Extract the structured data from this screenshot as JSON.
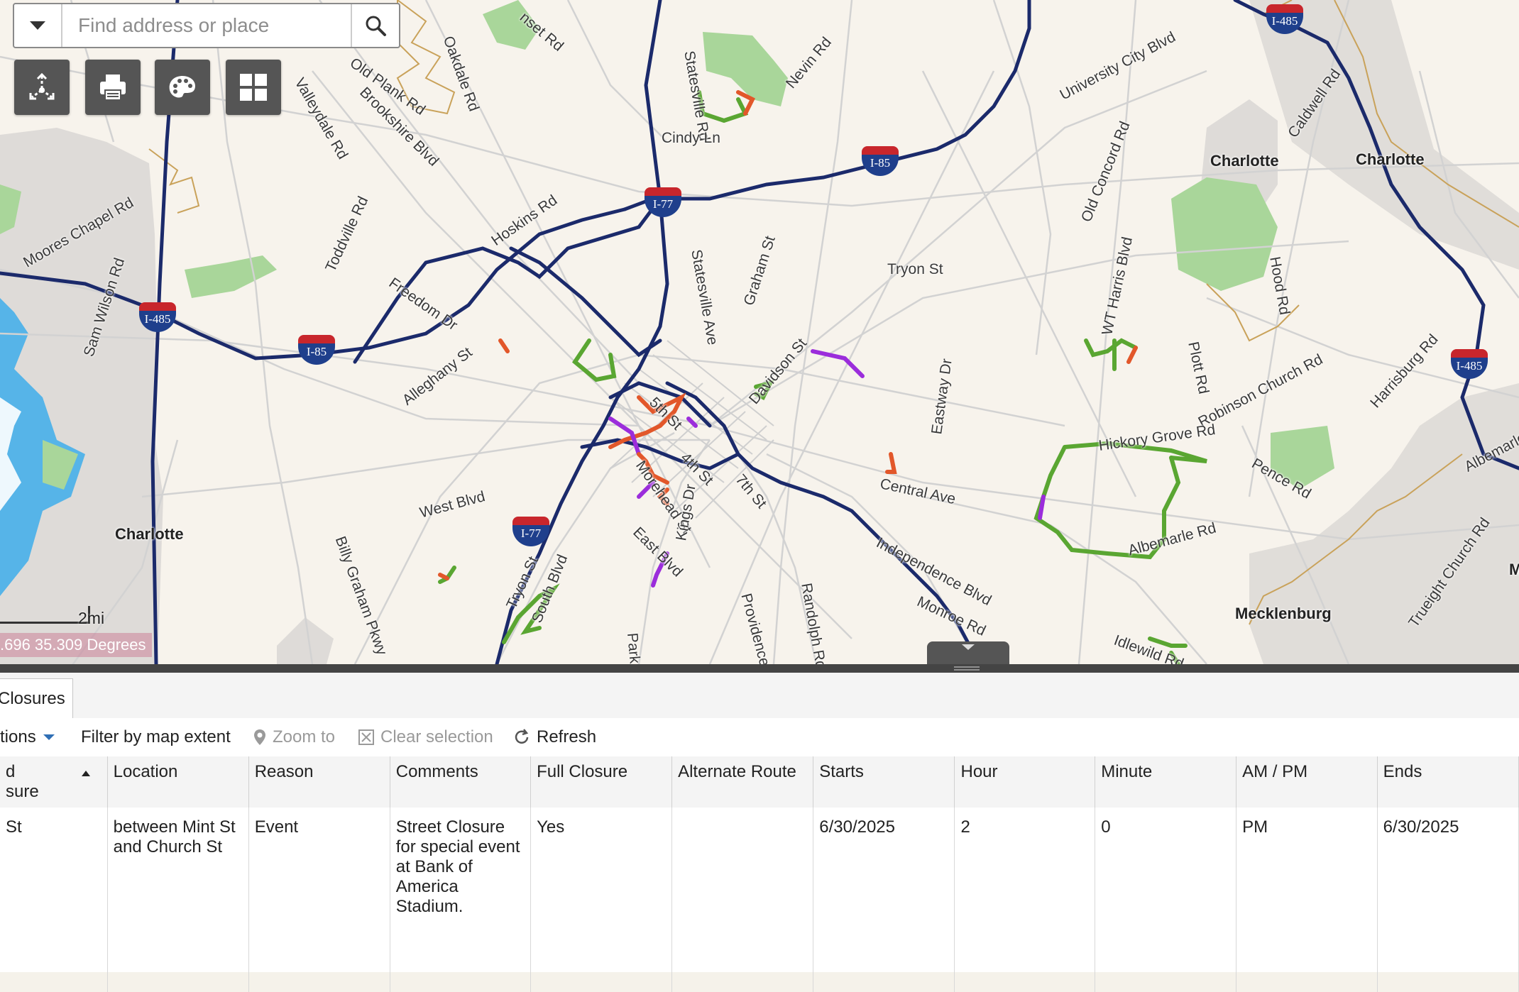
{
  "search": {
    "placeholder": "Find address or place"
  },
  "toolbar": {
    "tools": [
      {
        "name": "measure",
        "icon": "measure-icon"
      },
      {
        "name": "print",
        "icon": "printer-icon"
      },
      {
        "name": "basemap",
        "icon": "palette-icon"
      },
      {
        "name": "gallery",
        "icon": "grid-icon"
      }
    ]
  },
  "map": {
    "scale_label": "2mi",
    "coordinates": ".696 35.309 Degrees",
    "colors": {
      "water": "#56b4e8",
      "park": "#a9d69a",
      "highway": "#1b2a6b",
      "road": "#d2d2d2",
      "boundary": "#c9a25a",
      "closure_full": "#e2572a",
      "closure_partial": "#5aa632",
      "closure_event": "#9b2ddb"
    },
    "cities": [
      "Charlotte",
      "Charlotte",
      "Charlotte",
      "Mecklenburg",
      "M"
    ],
    "roads": [
      "nset Rd",
      "Oakdale Rd",
      "Old Plank Rd",
      "Brookshire Blvd",
      "Valleydale Rd",
      "Statesville Rd",
      "Nevin Rd",
      "University City Blvd",
      "Caldwell Rd",
      "Cindy Ln",
      "Old Concord Rd",
      "Moores Chapel Rd",
      "Toddville Rd",
      "Hoskins Rd",
      "Statesville Ave",
      "Graham St",
      "Tryon St",
      "WT Harris Blvd",
      "Hood Rd",
      "Sam Wilson Rd",
      "Freedom Dr",
      "Plott Rd",
      "Robinson Church Rd",
      "Harrisburg Rd",
      "Alleghany St",
      "Davidson St",
      "5th St",
      "4th St",
      "7th St",
      "Eastway Dr",
      "Hickory Grove Rd",
      "Pence Rd",
      "Albemarle",
      "Morehead St",
      "Central Ave",
      "West Blvd",
      "East Blvd",
      "Kings Dr",
      "Independence Blvd",
      "Albemarle Rd",
      "Billy Graham Pkwy",
      "Tryon St",
      "South Blvd",
      "Park Rd",
      "Providence Rd",
      "Randolph Rd",
      "Monroe Rd",
      "Idlewild Rd",
      "Trueight Church Rd",
      "Albemarle Rd"
    ],
    "shields": [
      "I-485",
      "I-85",
      "I-77",
      "I-485",
      "I-85",
      "I-77",
      "I-485"
    ]
  },
  "panel": {
    "tab_label": "Closures",
    "options_label": "tions",
    "filter_label": "Filter by map extent",
    "zoom_label": "Zoom to",
    "clear_label": "Clear selection",
    "refresh_label": "Refresh",
    "columns": [
      "d\nsure",
      "Location",
      "Reason",
      "Comments",
      "Full Closure",
      "Alternate Route",
      "Starts",
      "Hour",
      "Minute",
      "AM / PM",
      "Ends"
    ],
    "rows": [
      {
        "street": "St",
        "location": "between Mint St and Church St",
        "reason": "Event",
        "comments": "Street Closure for special event at Bank of America Stadium.",
        "full_closure": "Yes",
        "alternate_route": "",
        "starts": "6/30/2025",
        "hour": "2",
        "minute": "0",
        "ampm": "PM",
        "ends": "6/30/2025"
      }
    ]
  }
}
